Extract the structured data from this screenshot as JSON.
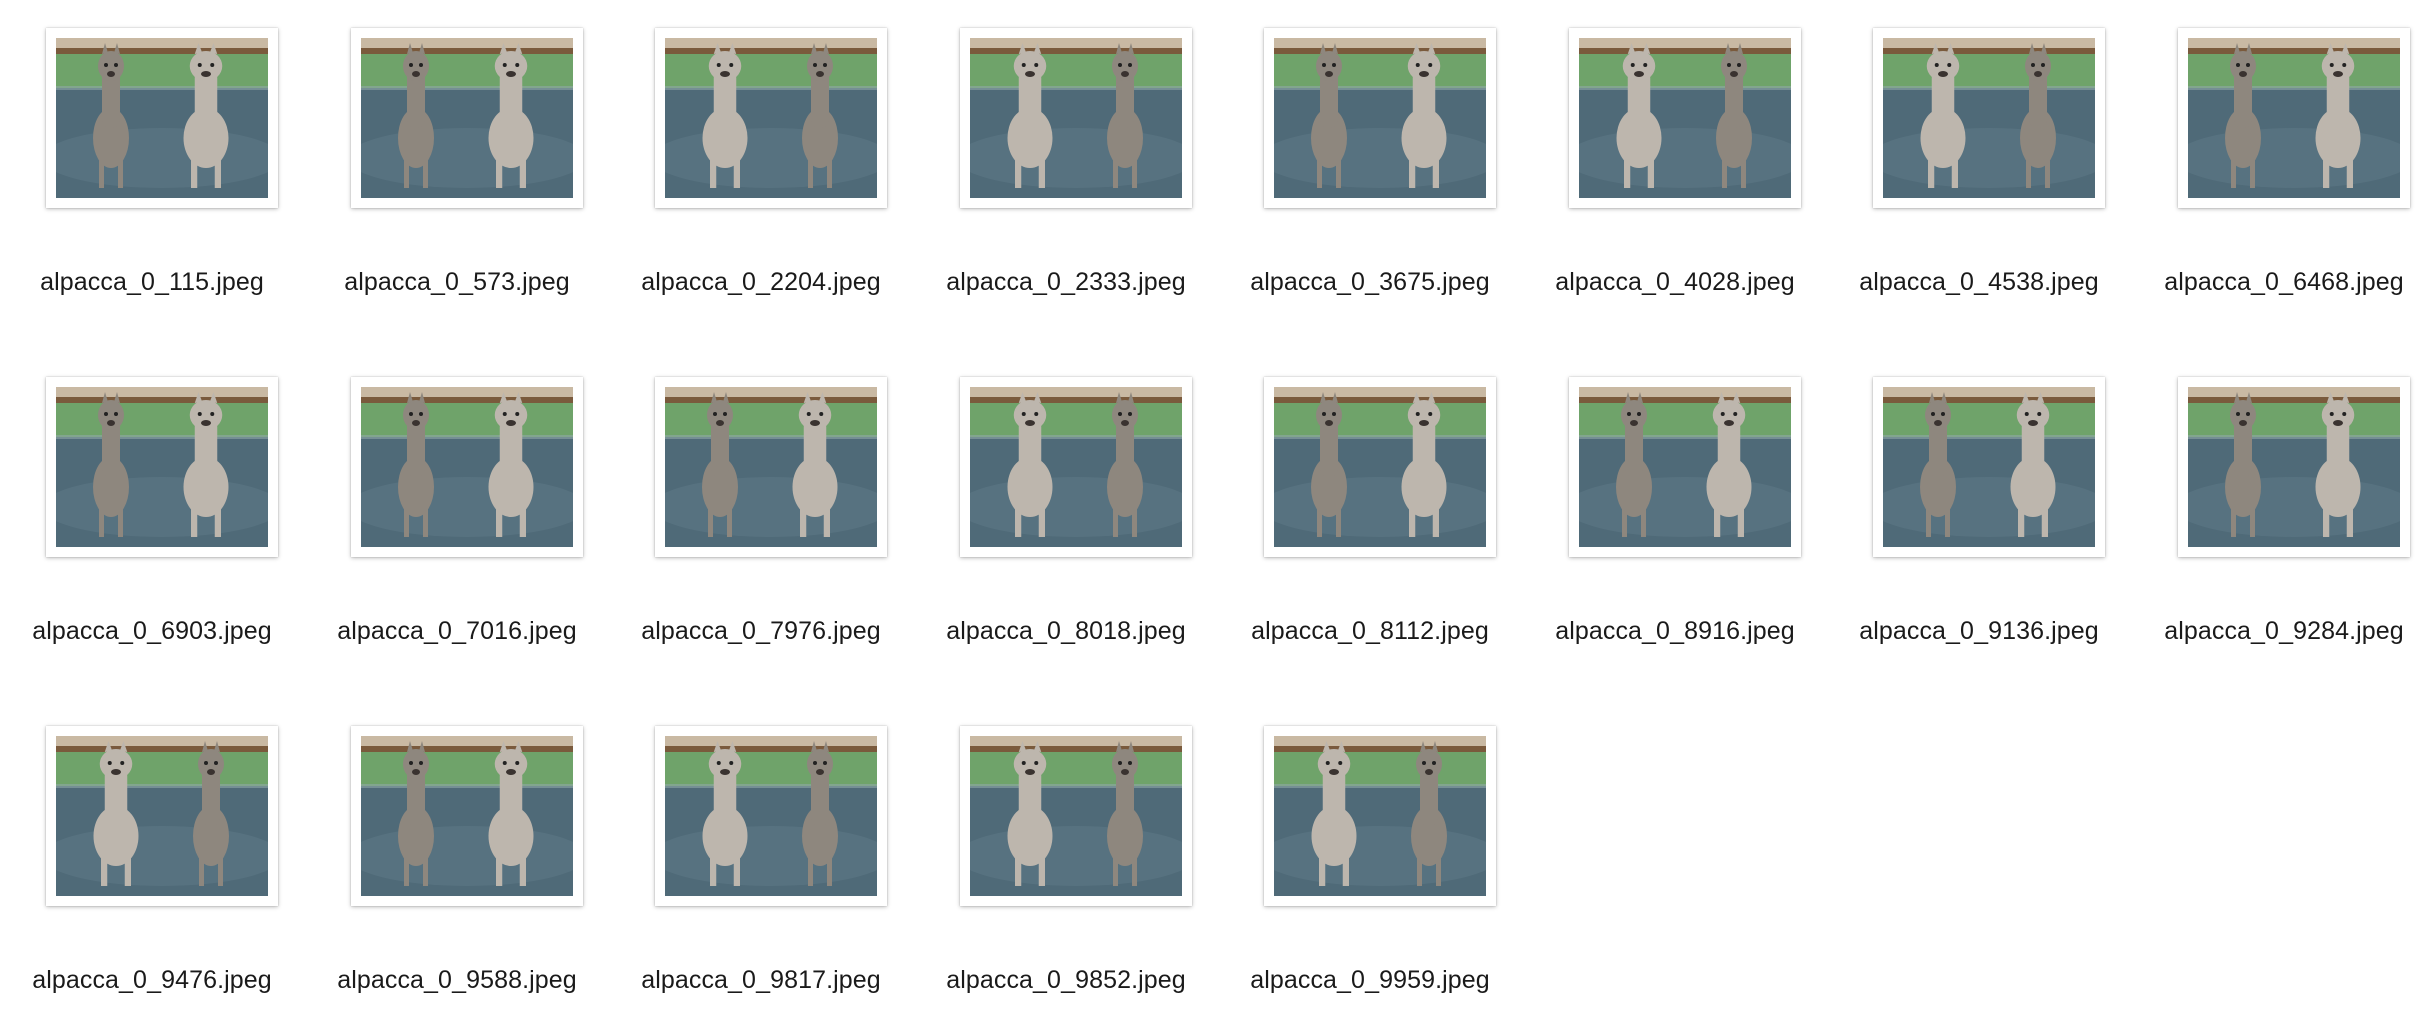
{
  "files": [
    {
      "name": "alpacca_0_115.jpeg",
      "variant": "A"
    },
    {
      "name": "alpacca_0_573.jpeg",
      "variant": "A"
    },
    {
      "name": "alpacca_0_2204.jpeg",
      "variant": "B"
    },
    {
      "name": "alpacca_0_2333.jpeg",
      "variant": "B"
    },
    {
      "name": "alpacca_0_3675.jpeg",
      "variant": "A"
    },
    {
      "name": "alpacca_0_4028.jpeg",
      "variant": "B"
    },
    {
      "name": "alpacca_0_4538.jpeg",
      "variant": "B"
    },
    {
      "name": "alpacca_0_6468.jpeg",
      "variant": "A"
    },
    {
      "name": "alpacca_0_6903.jpeg",
      "variant": "A"
    },
    {
      "name": "alpacca_0_7016.jpeg",
      "variant": "A"
    },
    {
      "name": "alpacca_0_7976.jpeg",
      "variant": "A"
    },
    {
      "name": "alpacca_0_8018.jpeg",
      "variant": "B"
    },
    {
      "name": "alpacca_0_8112.jpeg",
      "variant": "A"
    },
    {
      "name": "alpacca_0_8916.jpeg",
      "variant": "A"
    },
    {
      "name": "alpacca_0_9136.jpeg",
      "variant": "A"
    },
    {
      "name": "alpacca_0_9284.jpeg",
      "variant": "A"
    },
    {
      "name": "alpacca_0_9476.jpeg",
      "variant": "B"
    },
    {
      "name": "alpacca_0_9588.jpeg",
      "variant": "A"
    },
    {
      "name": "alpacca_0_9817.jpeg",
      "variant": "B"
    },
    {
      "name": "alpacca_0_9852.jpeg",
      "variant": "B"
    },
    {
      "name": "alpacca_0_9959.jpeg",
      "variant": "B"
    }
  ],
  "colors": {
    "sky": "#c9b9a3",
    "fence": "#7a5a3c",
    "grass": "#6fa36a",
    "ground": "#4f6a78",
    "alpaca": "#bdb6ad",
    "alpaca_dark": "#8e877e"
  }
}
